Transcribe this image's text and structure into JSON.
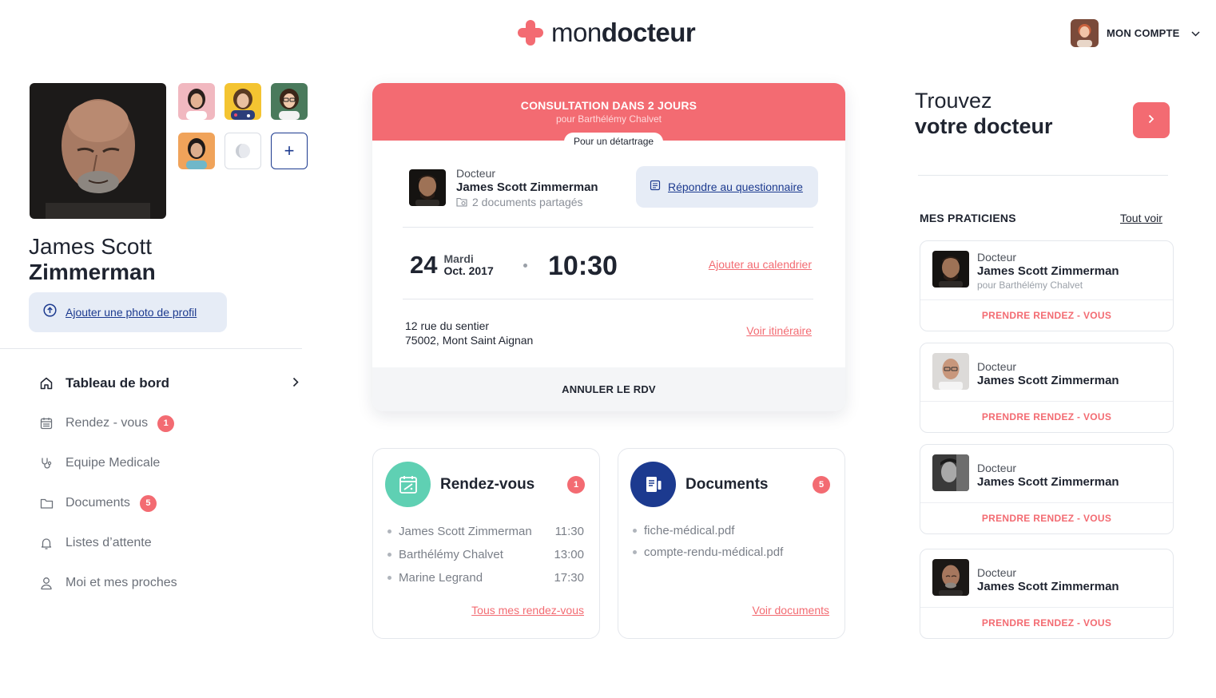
{
  "brand": {
    "name_light": "mon",
    "name_bold": "docteur",
    "accent": "#f36b72",
    "navy": "#1c3a8f"
  },
  "account": {
    "label": "MON COMPTE",
    "avatar_icon": "user-avatar-icon",
    "chevron_icon": "chevron-down-icon"
  },
  "profile": {
    "first_name": "James Scott",
    "last_name": "Zimmerman",
    "add_photo_label": "Ajouter une photo de profil",
    "add_thumb_label": "+"
  },
  "nav": {
    "items": [
      {
        "label": "Tableau de bord",
        "icon": "home-icon",
        "active": true
      },
      {
        "label": "Rendez - vous",
        "icon": "calendar-icon",
        "badge": "1"
      },
      {
        "label": "Equipe Medicale",
        "icon": "stethoscope-icon"
      },
      {
        "label": "Documents",
        "icon": "folder-icon",
        "badge": "5"
      },
      {
        "label": "Listes d’attente",
        "icon": "bell-icon"
      },
      {
        "label": "Moi et mes proches",
        "icon": "person-icon"
      }
    ]
  },
  "appointment": {
    "title": "CONSULTATION DANS 2 JOURS",
    "subtitle": "pour Barthélémy Chalvet",
    "reason": "Pour un détartrage",
    "doctor_role": "Docteur",
    "doctor_name": "James Scott Zimmerman",
    "shared_docs": "2 documents  partagés",
    "questionnaire_label": "Répondre au questionnaire",
    "day": "24",
    "weekday": "Mardi",
    "month_year": "Oct. 2017",
    "time": "10:30",
    "add_calendar": "Ajouter au calendrier",
    "address_line1": "12 rue du sentier",
    "address_line2": "75002, Mont Saint Aignan",
    "itinerary": "Voir itinéraire",
    "cancel": "ANNULER LE RDV"
  },
  "widgets": {
    "rdv": {
      "title": "Rendez-vous",
      "badge": "1",
      "icon": "calendar-widget-icon",
      "items": [
        {
          "name": "James Scott Zimmerman",
          "time": "11:30"
        },
        {
          "name": "Barthélémy Chalvet",
          "time": "13:00"
        },
        {
          "name": "Marine Legrand",
          "time": "17:30"
        }
      ],
      "link": "Tous mes rendez-vous"
    },
    "documents": {
      "title": "Documents",
      "badge": "5",
      "icon": "document-widget-icon",
      "items": [
        "fiche-médical.pdf",
        "compte-rendu-médical.pdf"
      ],
      "link": "Voir documents"
    }
  },
  "finder": {
    "line1": "Trouvez",
    "line2": "votre docteur",
    "button_icon": "chevron-right-icon"
  },
  "practitioners": {
    "title": "MES PRATICIENS",
    "see_all": "Tout voir",
    "items": [
      {
        "role": "Docteur",
        "name": "James Scott Zimmerman",
        "for": "pour Barthélémy Chalvet",
        "cta": "PRENDRE RENDEZ - VOUS"
      },
      {
        "role": "Docteur",
        "name": "James Scott Zimmerman",
        "cta": "PRENDRE RENDEZ - VOUS"
      },
      {
        "role": "Docteur",
        "name": "James Scott Zimmerman",
        "cta": "PRENDRE RENDEZ - VOUS"
      },
      {
        "role": "Docteur",
        "name": "James Scott Zimmerman",
        "cta": "PRENDRE RENDEZ - VOUS"
      }
    ]
  }
}
